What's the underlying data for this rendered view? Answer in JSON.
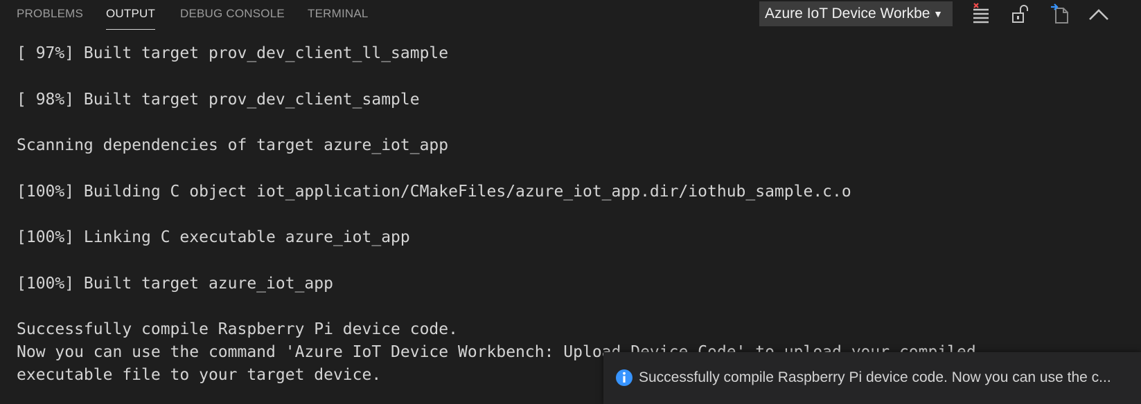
{
  "tabs": [
    {
      "label": "PROBLEMS",
      "active": false
    },
    {
      "label": "OUTPUT",
      "active": true
    },
    {
      "label": "DEBUG CONSOLE",
      "active": false
    },
    {
      "label": "TERMINAL",
      "active": false
    }
  ],
  "channel_select": {
    "selected": "Azure IoT Device Workbench"
  },
  "toolbar": {
    "icons": [
      "clear-output-icon",
      "lock-scroll-icon",
      "open-log-file-icon",
      "maximize-panel-icon"
    ]
  },
  "output_lines": [
    "[ 97%] Built target prov_dev_client_ll_sample",
    "[ 98%] Built target prov_dev_client_sample",
    "Scanning dependencies of target azure_iot_app",
    "[100%] Building C object iot_application/CMakeFiles/azure_iot_app.dir/iothub_sample.c.o",
    "[100%] Linking C executable azure_iot_app",
    "[100%] Built target azure_iot_app",
    "Successfully compile Raspberry Pi device code.",
    "Now you can use the command 'Azure IoT Device Workbench: Upload Device Code' to upload your compiled",
    "executable file to your target device."
  ],
  "notification": {
    "icon": "info-icon",
    "message": "Successfully compile Raspberry Pi device code. Now you can use the c..."
  },
  "colors": {
    "background": "#1e1e1e",
    "text": "#d4d4d4",
    "info_blue": "#3794ff",
    "clear_red": "#f14c4c"
  }
}
